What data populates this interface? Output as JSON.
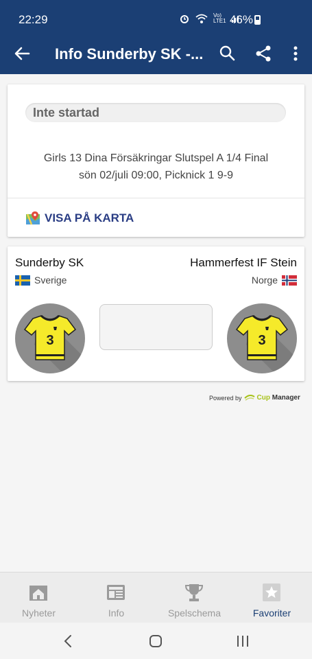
{
  "status_bar": {
    "time": "22:29",
    "network_label": "Vo) LTE1",
    "battery_percent": "46%"
  },
  "app_bar": {
    "title": "Info Sunderby SK -...",
    "actions": [
      "search-icon",
      "share-icon",
      "more-vert-icon"
    ]
  },
  "match": {
    "status": "Inte startad",
    "line1": "Girls 13 Dina Försäkringar Slutspel A 1/4 Final",
    "line2": "sön 02/juli 09:00, Picknick 1 9-9",
    "map_link": "VISA PÅ KARTA"
  },
  "teams": {
    "home": {
      "name": "Sunderby SK",
      "country": "Sverige",
      "shirt_number": "3"
    },
    "away": {
      "name": "Hammerfest IF Stein",
      "country": "Norge",
      "shirt_number": "3"
    }
  },
  "powered_by": {
    "label": "Powered by",
    "brand_cup": "Cup",
    "brand_manager": "Manager"
  },
  "bottom_nav": [
    {
      "label": "Nyheter",
      "icon": "news-home-icon",
      "active": false
    },
    {
      "label": "Info",
      "icon": "info-list-icon",
      "active": false
    },
    {
      "label": "Spelschema",
      "icon": "trophy-icon",
      "active": false
    },
    {
      "label": "Favoriter",
      "icon": "star-icon",
      "active": true
    }
  ],
  "colors": {
    "primary": "#1b3f74",
    "link": "#2a3d84",
    "shirt": "#f5ea2a",
    "brand_green": "#a8c21a"
  }
}
